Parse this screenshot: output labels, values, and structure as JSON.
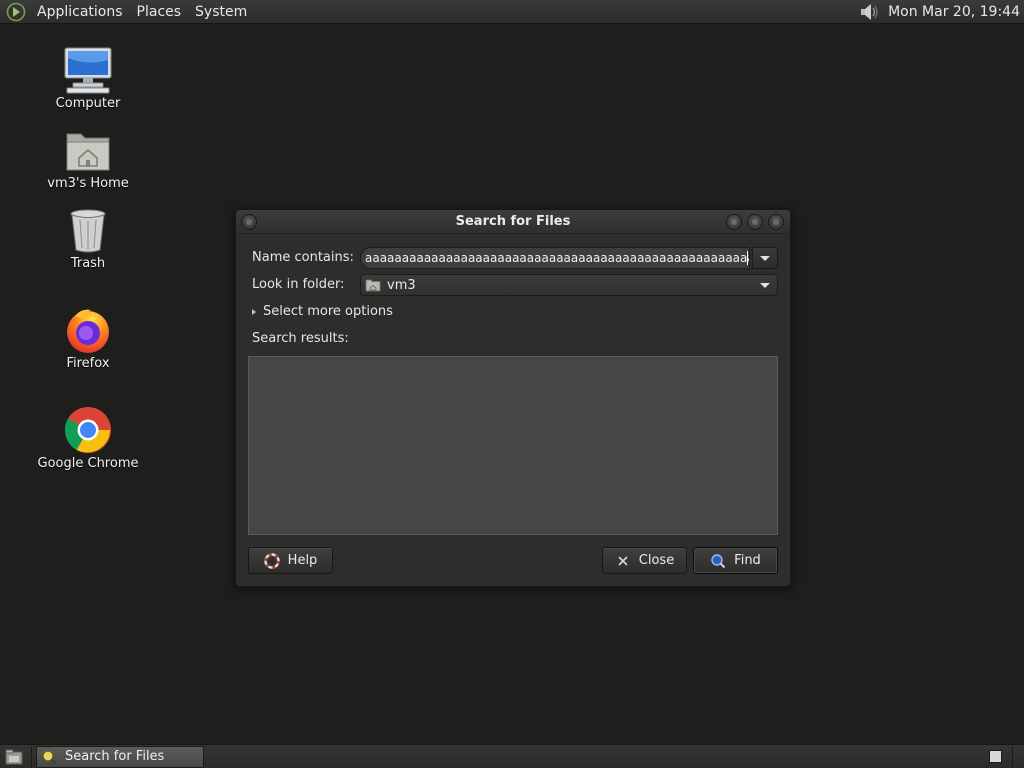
{
  "top_panel": {
    "menus": [
      "Applications",
      "Places",
      "System"
    ],
    "clock": "Mon Mar 20, 19:44",
    "logo_icon": "gnome-foot-icon",
    "volume_icon": "speaker-icon"
  },
  "desktop": {
    "icons": [
      {
        "label": "Computer",
        "icon": "computer-icon"
      },
      {
        "label": "vm3's Home",
        "icon": "home-folder-icon"
      },
      {
        "label": "Trash",
        "icon": "trash-icon"
      },
      {
        "label": "Firefox",
        "icon": "firefox-icon"
      },
      {
        "label": "Google Chrome",
        "icon": "chrome-icon"
      }
    ]
  },
  "dialog": {
    "title": "Search for Files",
    "name_label": "Name contains:",
    "name_value": "aaaaaaaaaaaaaaaaaaaaaaaaaaaaaaaaaaaaaaaaaaaaaaaaaaaaaaaaaa",
    "folder_label": "Look in folder:",
    "folder_value": "vm3",
    "more_options": "Select more options",
    "results_label": "Search results:",
    "help_button": "Help",
    "close_button": "Close",
    "find_button": "Find"
  },
  "bottom_panel": {
    "task_label": "Search for Files",
    "show_desktop_icon": "show-desktop-icon"
  },
  "colors": {
    "desktop_bg": "#1e1f1c",
    "panel_bg": "#2c2d2a",
    "dialog_bg": "#2d2e2c",
    "results_bg": "#464744"
  }
}
